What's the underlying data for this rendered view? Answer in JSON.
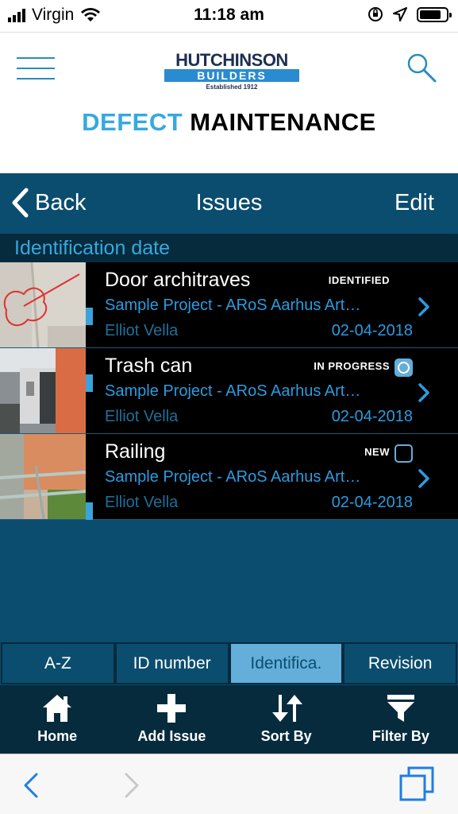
{
  "status": {
    "carrier": "Virgin",
    "time": "11:18 am"
  },
  "header": {
    "logo_line1": "HUTCHINSON",
    "logo_line2": "BUILDERS",
    "logo_line3": "Established 1912",
    "title_part1": "DEFECT",
    "title_part2": "MAINTENANCE"
  },
  "nav": {
    "back_label": "Back",
    "title": "Issues",
    "edit_label": "Edit"
  },
  "section_header": "Identification date",
  "issues": [
    {
      "title": "Door architraves",
      "status": "IDENTIFIED",
      "project": "Sample Project - ARoS Aarhus Art…",
      "user": "Elliot Vella",
      "date": "02-04-2018"
    },
    {
      "title": "Trash can",
      "status": "IN PROGRESS",
      "project": "Sample Project - ARoS Aarhus Art…",
      "user": "Elliot Vella",
      "date": "02-04-2018"
    },
    {
      "title": "Railing",
      "status": "NEW",
      "project": "Sample Project - ARoS Aarhus Art…",
      "user": "Elliot Vella",
      "date": "02-04-2018"
    }
  ],
  "sort_segments": [
    "A-Z",
    "ID number",
    "Identifica.",
    "Revision"
  ],
  "sort_active": "Identifica.",
  "tabs": [
    "Home",
    "Add Issue",
    "Sort By",
    "Filter By"
  ],
  "colors": {
    "accent": "#35a9e0",
    "nav_bg": "#0b4d6e",
    "dark_bg": "#062b3d",
    "active_segment": "#64aeda"
  },
  "icons": [
    "hamburger-menu-icon",
    "search-icon",
    "chevron-left-icon",
    "chevron-right-icon",
    "home-icon",
    "plus-icon",
    "sort-icon",
    "filter-icon",
    "tabs-icon"
  ]
}
